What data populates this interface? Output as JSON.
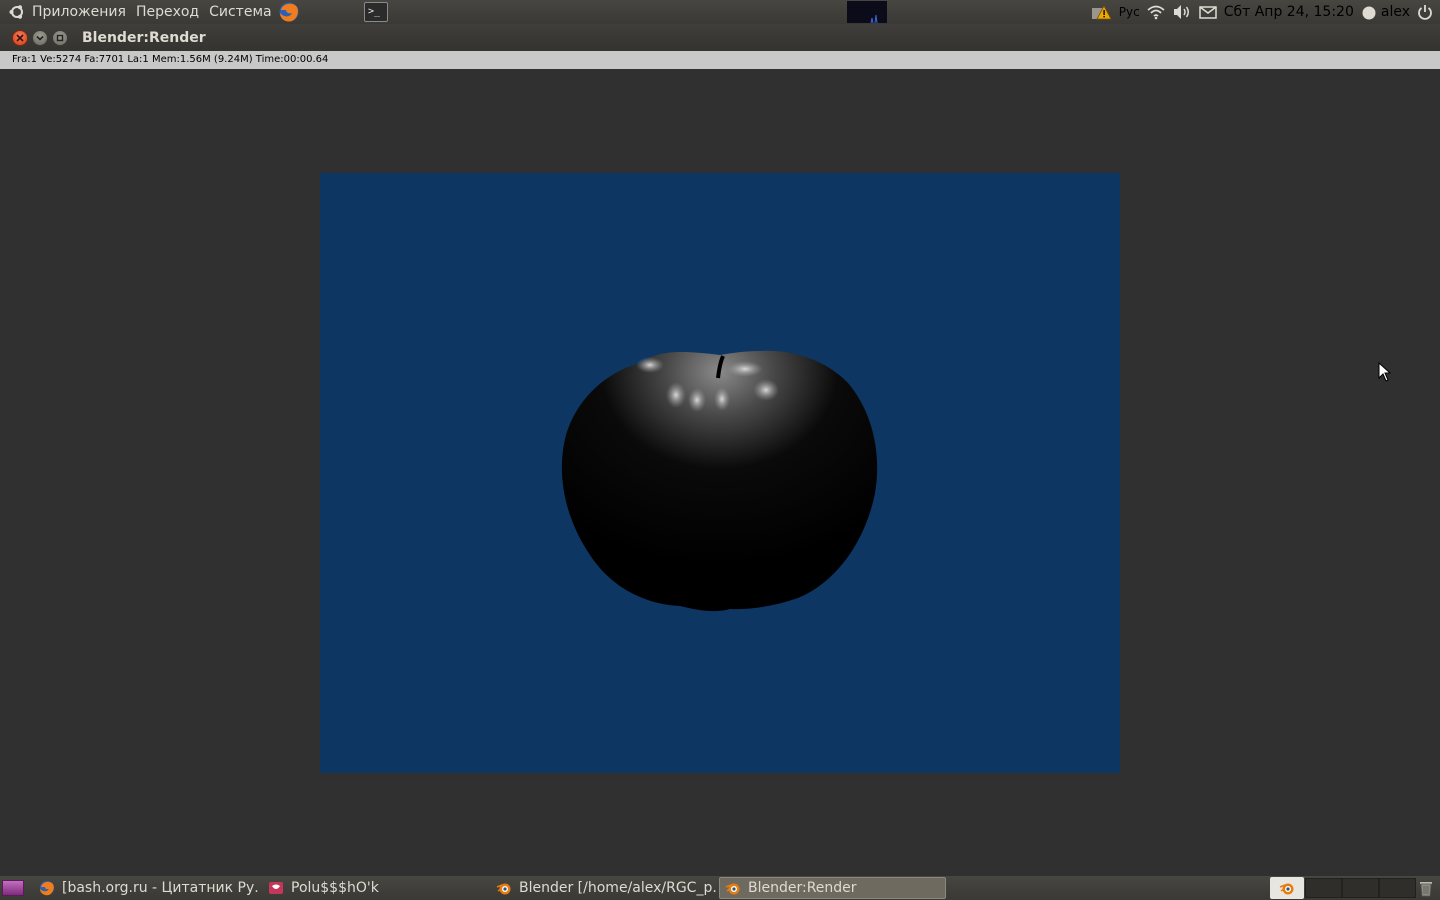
{
  "top_panel": {
    "menus": [
      "Приложения",
      "Переход",
      "Система"
    ],
    "keyboard_layout": "Рус",
    "clock": "Сбт Апр 24, 15:20",
    "user": "alex"
  },
  "window": {
    "title": "Blender:Render"
  },
  "render_info": {
    "text": "Fra:1  Ve:5274 Fa:7701 La:1 Mem:1.56M (9.24M) Time:00:00.64"
  },
  "render": {
    "background_color": "#0d3663",
    "subject": "apple"
  },
  "taskbar": {
    "tasks": [
      {
        "label": "[bash.org.ru - Цитатник Ру...",
        "icon": "firefox-icon",
        "active": false
      },
      {
        "label": "Polu$$$hO'k",
        "icon": "pidgin-icon",
        "active": false
      },
      {
        "label": "Blender [/home/alex/RGC_p...",
        "icon": "blender-icon",
        "active": false
      },
      {
        "label": "Blender:Render",
        "icon": "blender-icon",
        "active": true
      }
    ]
  }
}
